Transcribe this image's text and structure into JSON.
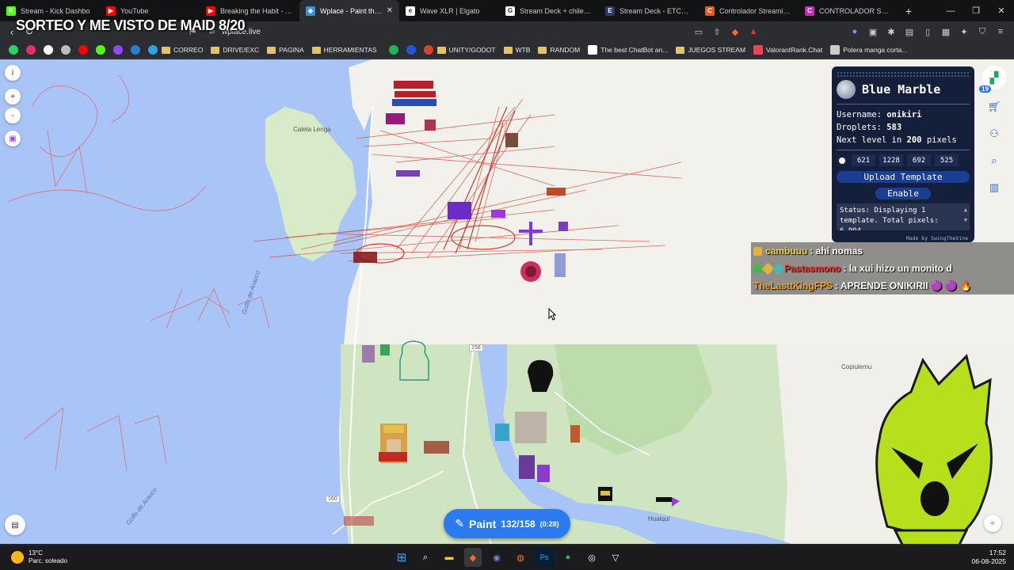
{
  "overlay": {
    "title": "SORTEO Y ME VISTO DE MAID 8/20"
  },
  "tabs": [
    {
      "label": "Stream - Kick Dashbo",
      "icon": "kick-icon",
      "color": "#53fc18",
      "glyph": "K"
    },
    {
      "label": "YouTube",
      "icon": "youtube-icon",
      "color": "#ff0000",
      "glyph": "▶"
    },
    {
      "label": "Breaking the Habit - YouTu",
      "icon": "youtube-icon",
      "color": "#ff0000",
      "glyph": "▶"
    },
    {
      "label": "Wplace - Paint the wo",
      "icon": "wplace-icon",
      "color": "#3a8dde",
      "glyph": "◆",
      "active": true
    },
    {
      "label": "Wave XLR | Elgato",
      "icon": "elgato-icon",
      "color": "#ffffff",
      "glyph": "e"
    },
    {
      "label": "Stream Deck + chile - Busc",
      "icon": "google-icon",
      "color": "#ffffff",
      "glyph": "G"
    },
    {
      "label": "Stream Deck - ETCHILE",
      "icon": "etchile-icon",
      "color": "#2d3a6a",
      "glyph": "E"
    },
    {
      "label": "Controlador Streaming Elg",
      "icon": "store-icon",
      "color": "#e05a2a",
      "glyph": "C"
    },
    {
      "label": "CONTROLADOR STREAMI",
      "icon": "store-icon",
      "color": "#c02fb4",
      "glyph": "C"
    }
  ],
  "address": {
    "url": "wplace.live"
  },
  "bookmarks": [
    {
      "label": "",
      "type": "whatsapp-icon",
      "color": "#25d366"
    },
    {
      "label": "",
      "type": "instagram-icon",
      "color": "#e1306c"
    },
    {
      "label": "",
      "type": "x-icon",
      "color": "#ffffff"
    },
    {
      "label": "",
      "type": "apple-icon",
      "color": "#bbbbbb"
    },
    {
      "label": "",
      "type": "youtube-icon",
      "color": "#ff0000"
    },
    {
      "label": "",
      "type": "kick-icon",
      "color": "#53fc18"
    },
    {
      "label": "",
      "type": "twitch-icon",
      "color": "#9146ff"
    },
    {
      "label": "",
      "type": "paypal-icon",
      "color": "#2a7fd4"
    },
    {
      "label": "",
      "type": "telegram-icon",
      "color": "#2aa3e0"
    },
    {
      "label": "CORREO",
      "type": "folder"
    },
    {
      "label": "DRIVE/EXC",
      "type": "folder"
    },
    {
      "label": "PAGINA",
      "type": "folder"
    },
    {
      "label": "HERRAMIENTAS",
      "type": "folder"
    },
    {
      "label": "",
      "type": "green-site-icon",
      "color": "#20b35a"
    },
    {
      "label": "",
      "type": "blue-site-icon",
      "color": "#2456d6"
    },
    {
      "label": "",
      "type": "red-site-icon",
      "color": "#d6452a"
    },
    {
      "label": "UNITY/GODOT",
      "type": "folder"
    },
    {
      "label": "WTB",
      "type": "folder"
    },
    {
      "label": "RANDOM",
      "type": "folder"
    },
    {
      "label": "The best ChatBot an...",
      "type": "chatbot-icon",
      "color": "#ffffff"
    },
    {
      "label": "JUEGOS STREAM",
      "type": "folder"
    },
    {
      "label": "ValorantRank.Chat",
      "type": "valorant-icon",
      "color": "#e4475b"
    },
    {
      "label": "Polera manga corta...",
      "type": "globe-icon",
      "color": "#cccccc"
    }
  ],
  "map": {
    "labels": {
      "caleta_lenga": "Caleta Lenga",
      "golfo_arauco_1": "Golfo de Arauco",
      "golfo_arauco_2": "Golfo de Arauco",
      "copiulemu": "Copiulemu",
      "hualqui": "Hualqui",
      "road_156": "156",
      "road_160": "160"
    },
    "left_buttons": [
      {
        "glyph": "i",
        "icon": "info-icon"
      },
      {
        "glyph": "+",
        "icon": "zoom-in-icon"
      },
      {
        "glyph": "-",
        "icon": "zoom-out-icon"
      },
      {
        "glyph": "▣",
        "icon": "twitch-icon"
      }
    ],
    "rail": {
      "badge": "19"
    }
  },
  "blue_marble": {
    "title": "Blue Marble",
    "username_label": "Username:",
    "username": "onikiri",
    "droplets_label": "Droplets:",
    "droplets": "583",
    "next_level_prefix": "Next level in",
    "next_level_value": "200",
    "next_level_suffix": "pixels",
    "coords": [
      "621",
      "1228",
      "692",
      "525"
    ],
    "upload_label": "Upload Template",
    "enable_label": "Enable",
    "status": "Status: Displaying 1 template. Total pixels: 6,994",
    "footer": "Made by SwingTheVine"
  },
  "chat": [
    {
      "user": "cambuuu",
      "user_color": "#f0d44a",
      "message": ": ahí nomas"
    },
    {
      "user": "Pastasmono",
      "user_color": "#ff2a2a",
      "message": ": la xui hizo un monito d"
    },
    {
      "user": "TheLasttKingFPS",
      "user_color": "#f5a623",
      "message": ": APRENDE ONIKIRII 🟣 🟣 🔥"
    }
  ],
  "paint": {
    "label": "Paint",
    "count": "132/158",
    "timer": "(0:28)"
  },
  "taskbar": {
    "temp": "13°C",
    "weather": "Parc. soleado",
    "time": "17:52",
    "date": "06-08-2025"
  }
}
